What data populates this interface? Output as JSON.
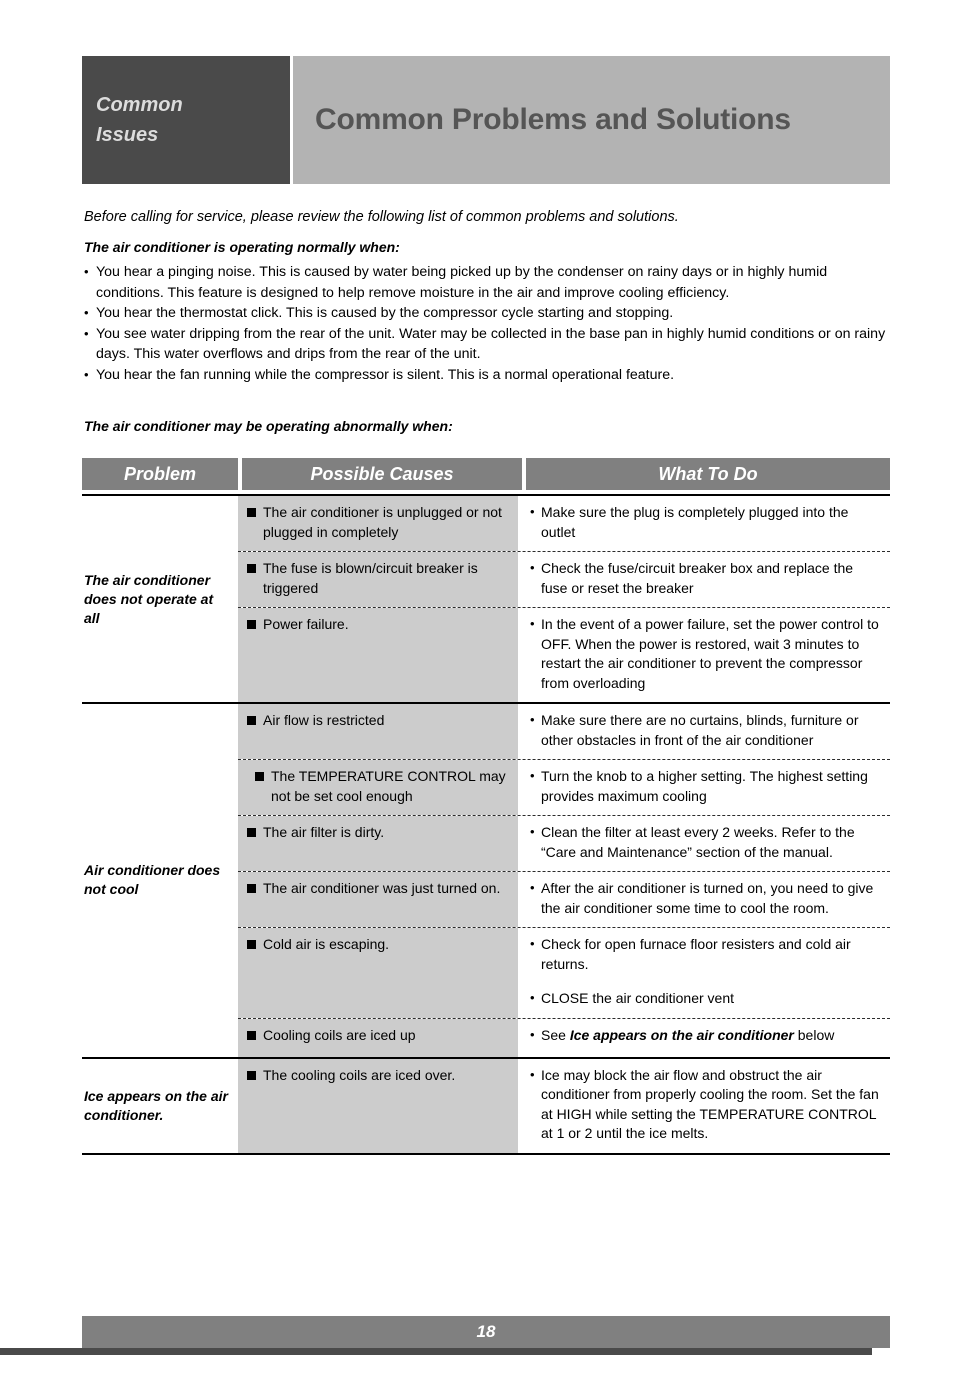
{
  "header": {
    "tab_line1": "Common",
    "tab_line2": "Issues",
    "title": "Common Problems and Solutions",
    "tab_bg": "#4a4a4a",
    "banner_bg": "#b3b3b3",
    "banner_text_color": "#555555"
  },
  "intro": {
    "lead": "Before calling for service, please review the following list of common problems and solutions.",
    "normal_heading": "The air conditioner is operating normally when:",
    "normal_bullets": [
      "You hear a pinging noise.  This is caused by water being picked up by the condenser on rainy days or in highly humid conditions. This feature is designed to help remove moisture in the air and improve cooling efficiency.",
      "You hear the thermostat click. This is caused by the compressor cycle starting and stopping.",
      "You see water dripping from the rear of the unit.  Water may be collected in the base pan in highly humid conditions or on rainy days. This water overflows and drips from the rear of the unit.",
      "You hear the fan running while the compressor is silent. This is a normal operational feature."
    ],
    "abnormal_heading": "The air conditioner may be operating abnormally when:"
  },
  "table": {
    "header_bg": "#808080",
    "cause_cell_bg": "#cccccc",
    "columns": [
      "Problem",
      "Possible Causes",
      "What To Do"
    ],
    "sections": [
      {
        "problem": "The air conditioner does not operate at all",
        "rows": [
          {
            "cause": "The air conditioner is unplugged or not plugged in completely",
            "cause_indent": false,
            "todos": [
              "Make sure the plug is completely plugged into the outlet"
            ]
          },
          {
            "cause": "The fuse is blown/circuit breaker is triggered",
            "cause_indent": false,
            "todos": [
              "Check the fuse/circuit breaker box and replace the fuse or reset the breaker"
            ]
          },
          {
            "cause": "Power failure.",
            "cause_indent": false,
            "todos": [
              "In the event of a power failure, set the power control to OFF. When the power is restored, wait 3 minutes to restart the air conditioner to prevent the compressor from overloading"
            ]
          }
        ]
      },
      {
        "problem": "Air conditioner does not cool",
        "rows": [
          {
            "cause": "Air flow is restricted",
            "cause_indent": false,
            "todos": [
              "Make sure there are no curtains, blinds, furniture or other obstacles in front of the air conditioner"
            ]
          },
          {
            "cause": "The TEMPERATURE CONTROL may not be set cool enough",
            "cause_indent": true,
            "todos": [
              "Turn the knob to a higher setting. The highest setting provides maximum cooling"
            ]
          },
          {
            "cause": "The air filter is dirty.",
            "cause_indent": false,
            "todos": [
              "Clean the filter at least every 2 weeks. Refer to the “Care and Maintenance” section of the manual."
            ]
          },
          {
            "cause": "The air conditioner was just turned on.",
            "cause_indent": false,
            "todos": [
              "After the air conditioner is turned on, you need to give the air conditioner some time to cool the room."
            ]
          },
          {
            "cause": "Cold air is escaping.",
            "cause_indent": false,
            "todos": [
              "Check for open furnace floor resisters and cold air returns.",
              "CLOSE the air conditioner vent"
            ]
          },
          {
            "cause": "Cooling coils are iced up",
            "cause_indent": false,
            "todos_html": [
              "See <i>Ice appears on the air conditioner</i> below"
            ]
          }
        ]
      },
      {
        "problem": "Ice appears on the air conditioner.",
        "rows": [
          {
            "cause": "The cooling coils are iced over.",
            "cause_indent": false,
            "todos": [
              "Ice may block the air flow and obstruct the air conditioner from properly cooling the room.  Set the fan at HIGH while setting the TEMPERATURE CONTROL at 1 or 2 until the ice melts."
            ]
          }
        ]
      }
    ]
  },
  "footer": {
    "page_number": "18"
  }
}
